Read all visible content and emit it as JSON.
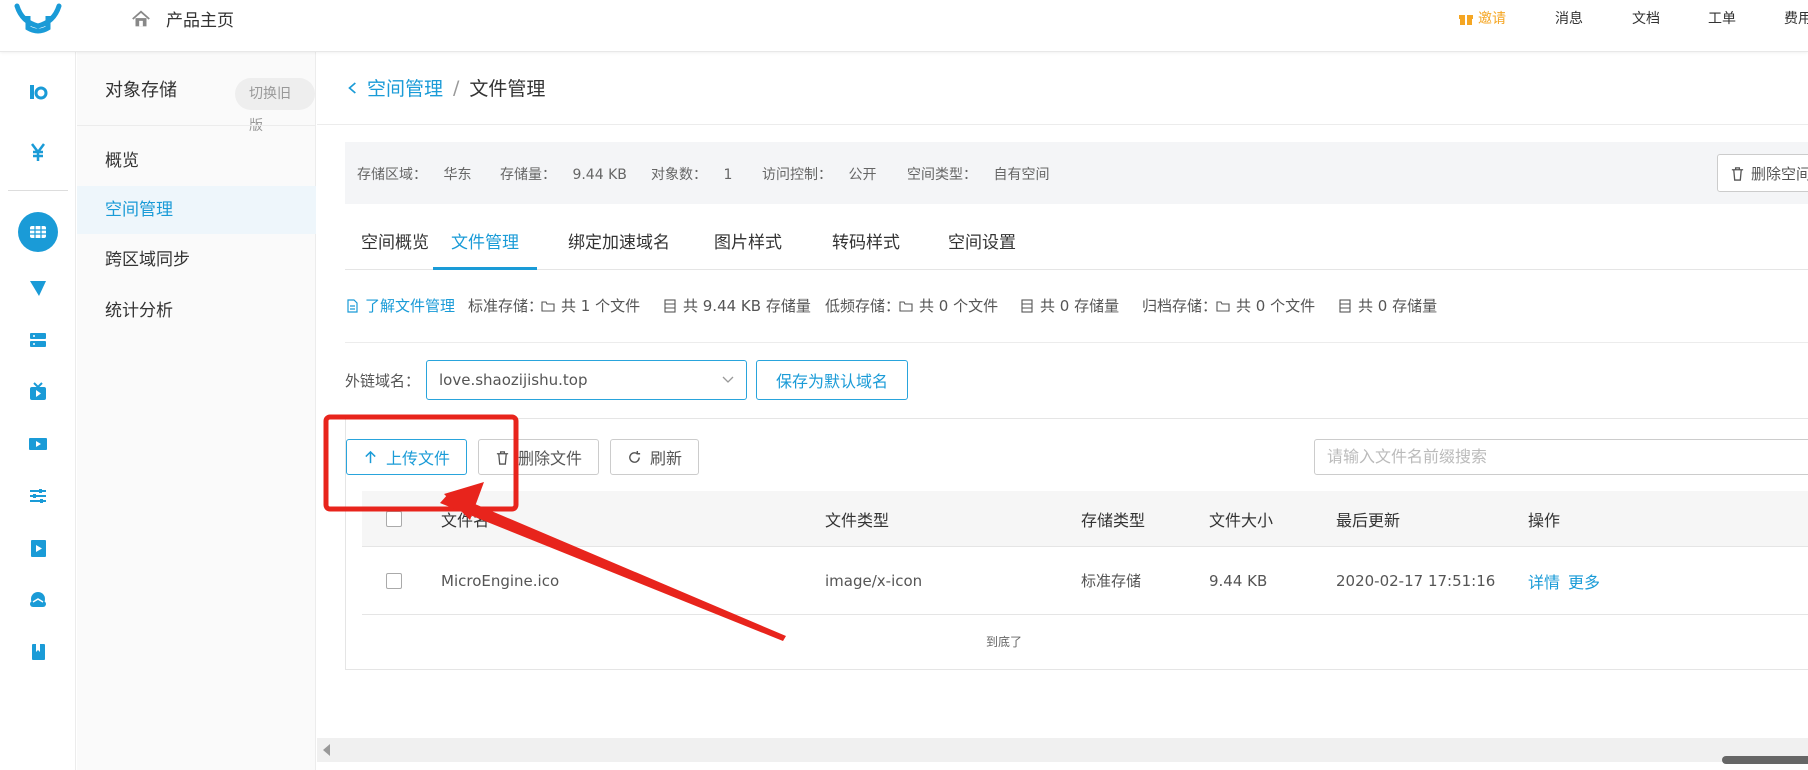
{
  "topbar": {
    "home_label": "产品主页",
    "nav": {
      "invite": "邀请",
      "messages": "消息",
      "docs": "文档",
      "tickets": "工单",
      "billing": "费用"
    }
  },
  "sidemenu": {
    "title": "对象存储",
    "switch_label": "切换旧版",
    "items": [
      {
        "label": "概览"
      },
      {
        "label": "空间管理",
        "active": true
      },
      {
        "label": "跨区域同步"
      },
      {
        "label": "统计分析"
      }
    ]
  },
  "breadcrumb": {
    "back": "空间管理",
    "separator": "/",
    "current": "文件管理"
  },
  "info": {
    "region_label": "存储区域：",
    "region": "华东",
    "storage_label": "存储量：",
    "storage": "9.44 KB",
    "objects_label": "对象数：",
    "objects": "1",
    "access_label": "访问控制：",
    "access": "公开",
    "type_label": "空间类型：",
    "type": "自有空间",
    "delete_space": "删除空间"
  },
  "tabs": [
    {
      "label": "空间概览"
    },
    {
      "label": "文件管理",
      "active": true
    },
    {
      "label": "绑定加速域名"
    },
    {
      "label": "图片样式"
    },
    {
      "label": "转码样式"
    },
    {
      "label": "空间设置"
    }
  ],
  "stats": {
    "learn": "了解文件管理",
    "standard_label": "标准存储：",
    "standard_files": "共 1 个文件",
    "standard_size": "共 9.44 KB 存储量",
    "infrequent_label": "低频存储：",
    "infrequent_files": "共 0 个文件",
    "infrequent_size": "共 0 存储量",
    "archive_label": "归档存储：",
    "archive_files": "共 0 个文件",
    "archive_size": "共 0 存储量"
  },
  "domain": {
    "label": "外链域名：",
    "value": "love.shaozijishu.top",
    "save_default": "保存为默认域名"
  },
  "toolbar": {
    "upload": "上传文件",
    "delete": "删除文件",
    "refresh": "刷新",
    "search_placeholder": "请输入文件名前缀搜索"
  },
  "table": {
    "headers": {
      "name": "文件名",
      "type": "文件类型",
      "storage": "存储类型",
      "size": "文件大小",
      "updated": "最后更新",
      "ops": "操作"
    },
    "rows": [
      {
        "name": "MicroEngine.ico",
        "type": "image/x-icon",
        "storage": "标准存储",
        "size": "9.44 KB",
        "updated": "2020-02-17 17:51:16",
        "detail": "详情",
        "more": "更多"
      }
    ],
    "end_text": "到底了"
  },
  "colors": {
    "accent": "#1a9bd7",
    "annotation": "#e8241c",
    "invite": "#f5a623"
  }
}
